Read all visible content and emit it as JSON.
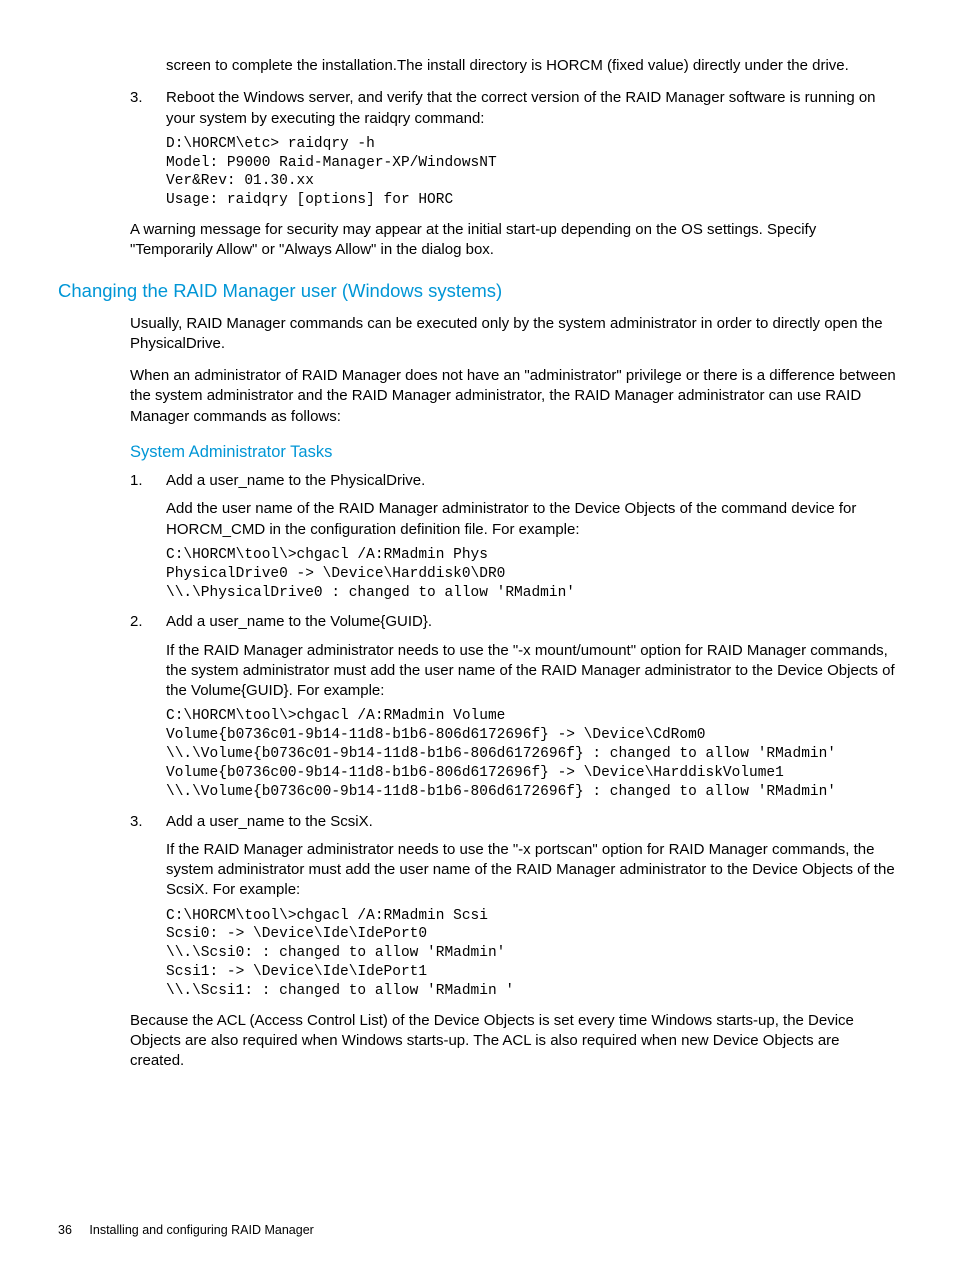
{
  "topSection": {
    "contPara": "screen to complete the installation.The install directory is HORCM (fixed value) directly under the drive.",
    "item3": {
      "num": "3.",
      "text": "Reboot the Windows server, and verify that the correct version of the RAID Manager software is running on your system by executing the raidqry command:",
      "code": "D:\\HORCM\\etc> raidqry -h\nModel: P9000 Raid-Manager-XP/WindowsNT\nVer&Rev: 01.30.xx\nUsage: raidqry [options] for HORC"
    },
    "warningPara": "A warning message for security may appear at the initial start-up depending on the OS settings. Specify \"Temporarily Allow\" or \"Always Allow\" in the dialog box."
  },
  "sectionHeading": "Changing the RAID Manager user (Windows systems)",
  "sectionBody": {
    "p1": "Usually, RAID Manager commands can be executed only by the system administrator in order to directly open the PhysicalDrive.",
    "p2": "When an administrator of RAID Manager does not have an \"administrator\" privilege or there is a difference between the system administrator and the RAID Manager administrator, the RAID Manager administrator can use RAID Manager commands as follows:"
  },
  "subHeading": "System Administrator Tasks",
  "tasks": {
    "t1": {
      "num": "1.",
      "title": "Add a user_name to the PhysicalDrive.",
      "desc": "Add the user name of the RAID Manager administrator to the Device Objects of the command device for HORCM_CMD in the configuration definition file. For example:",
      "code": "C:\\HORCM\\tool\\>chgacl /A:RMadmin Phys\nPhysicalDrive0 -> \\Device\\Harddisk0\\DR0\n\\\\.\\PhysicalDrive0 : changed to allow 'RMadmin'"
    },
    "t2": {
      "num": "2.",
      "title": "Add a user_name to the Volume{GUID}.",
      "desc": "If the RAID Manager administrator needs to use the \"-x mount/umount\" option for RAID Manager commands, the system administrator must add the user name of the RAID Manager administrator to the Device Objects of the Volume{GUID}. For example:",
      "code": "C:\\HORCM\\tool\\>chgacl /A:RMadmin Volume\nVolume{b0736c01-9b14-11d8-b1b6-806d6172696f} -> \\Device\\CdRom0\n\\\\.\\Volume{b0736c01-9b14-11d8-b1b6-806d6172696f} : changed to allow 'RMadmin'\nVolume{b0736c00-9b14-11d8-b1b6-806d6172696f} -> \\Device\\HarddiskVolume1\n\\\\.\\Volume{b0736c00-9b14-11d8-b1b6-806d6172696f} : changed to allow 'RMadmin'"
    },
    "t3": {
      "num": "3.",
      "title": "Add a user_name to the ScsiX.",
      "desc": "If the RAID Manager administrator needs to use the \"-x portscan\" option for RAID Manager commands, the system administrator must add the user name of the RAID Manager administrator to the Device Objects of the ScsiX. For example:",
      "code": "C:\\HORCM\\tool\\>chgacl /A:RMadmin Scsi\nScsi0: -> \\Device\\Ide\\IdePort0\n\\\\.\\Scsi0: : changed to allow 'RMadmin'\nScsi1: -> \\Device\\Ide\\IdePort1\n\\\\.\\Scsi1: : changed to allow 'RMadmin '"
    }
  },
  "closingPara": "Because the ACL (Access Control List) of the Device Objects is set every time Windows starts-up, the Device Objects are also required when Windows starts-up. The ACL is also required when new Device Objects are created.",
  "footer": {
    "pageNum": "36",
    "chapter": "Installing and configuring RAID Manager"
  }
}
